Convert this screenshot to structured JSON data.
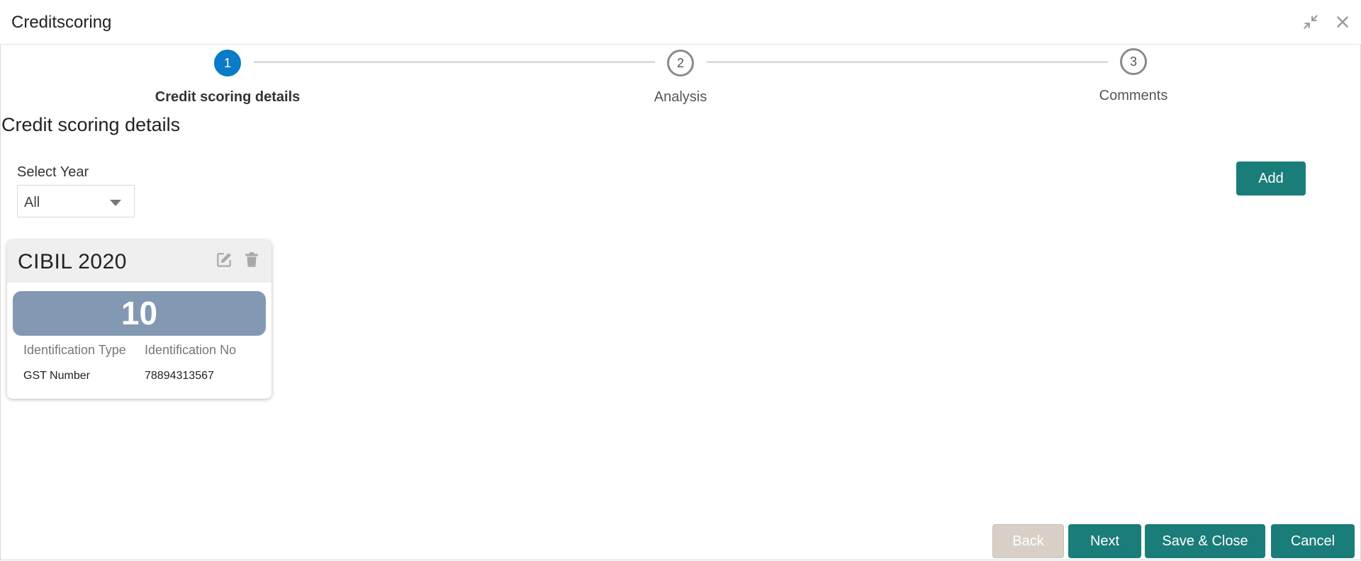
{
  "window": {
    "title": "Creditscoring",
    "minimize_icon": "collapse-arrows-icon",
    "close_icon": "close-icon"
  },
  "stepper": {
    "steps": [
      {
        "number": "1",
        "label": "Credit scoring details",
        "active": true
      },
      {
        "number": "2",
        "label": "Analysis",
        "active": false
      },
      {
        "number": "3",
        "label": "Comments",
        "active": false
      }
    ]
  },
  "section": {
    "title": "Credit scoring details"
  },
  "filter": {
    "label": "Select Year",
    "selected": "All"
  },
  "add_button": "Add",
  "card": {
    "title": "CIBIL 2020",
    "score": "10",
    "columns": [
      {
        "header": "Identification Type",
        "value": "GST Number"
      },
      {
        "header": "Identification No",
        "value": "78894313567"
      }
    ],
    "edit_icon": "edit-icon",
    "delete_icon": "trash-icon"
  },
  "footer": {
    "back": "Back",
    "next": "Next",
    "save_close": "Save & Close",
    "cancel": "Cancel"
  },
  "colors": {
    "accent": "#1a7d7a",
    "step_active": "#0a7bc6",
    "score_bg": "#8399b3",
    "back_disabled": "#d8d0c6"
  }
}
